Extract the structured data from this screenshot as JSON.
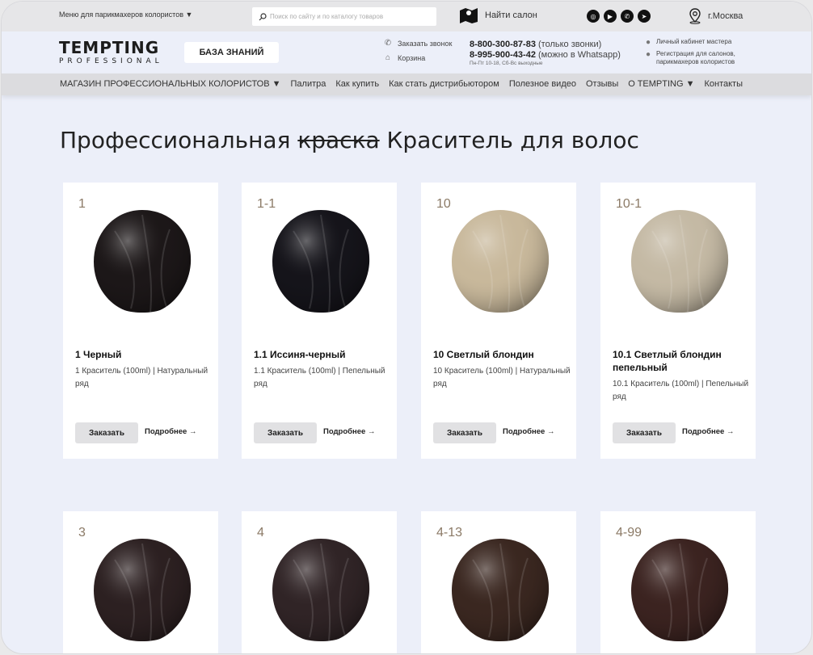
{
  "topbar": {
    "menu_label": "Меню для парикмахеров колористов ▼",
    "search_placeholder": "Поиск по сайту и по каталогу товаров",
    "find_salon": "Найти салон",
    "city": "г.Москва"
  },
  "header": {
    "logo_main": "TEMPTING",
    "logo_sub": "PROFESSIONAL",
    "knowledge_base": "БАЗА ЗНАНИЙ",
    "callback": "Заказать звонок",
    "cart": "Корзина",
    "phone1": "8-800-300-87-83",
    "phone1_note": "(только звонки)",
    "phone2": "8-995-900-43-42",
    "phone2_note": "(можно в Whatsapp)",
    "hours": "Пн-Пт 10-18, Сб-Вс выходные",
    "cabinet": "Личный кабинет мастера",
    "register": "Регистрация для салонов, парикмахеров колористов"
  },
  "nav": {
    "items": [
      "МАГАЗИН ПРОФЕССИОНАЛЬНЫХ КОЛОРИСТОВ ▼",
      "Палитра",
      "Как купить",
      "Как стать дистрибьютором",
      "Полезное видео",
      "Отзывы",
      "O TEMPTING ▼",
      "Контакты"
    ]
  },
  "page": {
    "title_pre": "Профессиональная",
    "title_struck": "краска",
    "title_post": "Краситель для волос"
  },
  "products": [
    {
      "code": "1",
      "title": "1 Черный",
      "desc": "1 Краситель (100ml) | Натуральный ряд",
      "order": "Заказать",
      "more": "Подробнее →",
      "color": "#1c1718"
    },
    {
      "code": "1-1",
      "title": "1.1 Иссиня-черный",
      "desc": "1.1 Краситель (100ml) | Пепельный ряд",
      "order": "Заказать",
      "more": "Подробнее →",
      "color": "#15141a"
    },
    {
      "code": "10",
      "title": "10 Светлый блондин",
      "desc": "10 Краситель (100ml) | Натуральный ряд",
      "order": "Заказать",
      "more": "Подробнее →",
      "color": "#c8b89b"
    },
    {
      "code": "10-1",
      "title": "10.1 Светлый блондин пепельный",
      "desc": "10.1 Краситель (100ml) | Пепельный ряд",
      "order": "Заказать",
      "more": "Подробнее →",
      "color": "#c4b9a4"
    },
    {
      "code": "3",
      "title": "",
      "desc": "",
      "order": "",
      "more": "",
      "color": "#2c2021"
    },
    {
      "code": "4",
      "title": "",
      "desc": "",
      "order": "",
      "more": "",
      "color": "#302426"
    },
    {
      "code": "4-13",
      "title": "",
      "desc": "",
      "order": "",
      "more": "",
      "color": "#3a2720"
    },
    {
      "code": "4-99",
      "title": "",
      "desc": "",
      "order": "",
      "more": "",
      "color": "#3b2320"
    }
  ]
}
